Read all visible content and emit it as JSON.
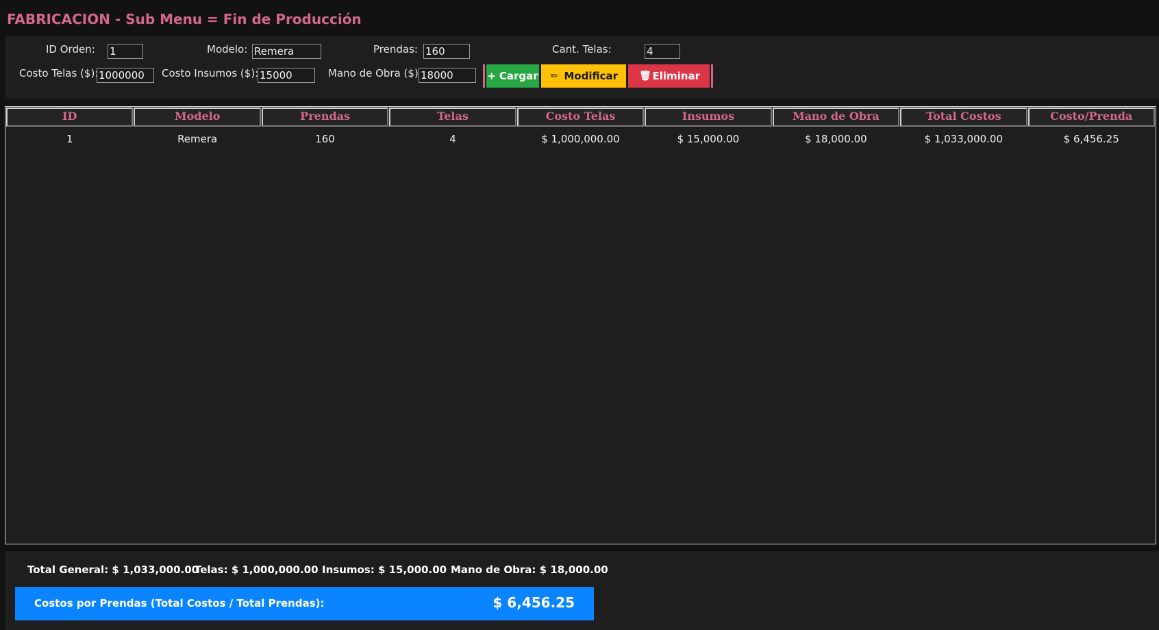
{
  "window": {
    "title": "FABRICACION - Sub Menu = Fin de Producción"
  },
  "form": {
    "id_orden": {
      "label": "ID Orden:",
      "value": "1"
    },
    "modelo": {
      "label": "Modelo:",
      "value": "Remera"
    },
    "prendas": {
      "label": "Prendas:",
      "value": "160"
    },
    "cant_telas": {
      "label": "Cant. Telas:",
      "value": "4"
    },
    "costo_telas": {
      "label": "Costo Telas ($):",
      "value": "1000000"
    },
    "costo_insumos": {
      "label": "Costo Insumos ($):",
      "value": "15000"
    },
    "mano_obra": {
      "label": "Mano de Obra ($):",
      "value": "18000"
    }
  },
  "buttons": {
    "cargar": {
      "label": "Cargar",
      "icon": "plus-icon",
      "glyph": "+",
      "color": "#28a745"
    },
    "modificar": {
      "label": "Modificar",
      "icon": "pencil-icon",
      "glyph": "✏",
      "color": "#ffc107"
    },
    "eliminar": {
      "label": "Eliminar",
      "icon": "trash-icon",
      "glyph": "🗑",
      "color": "#dc3545"
    }
  },
  "table": {
    "columns": [
      "ID",
      "Modelo",
      "Prendas",
      "Telas",
      "Costo Telas",
      "Insumos",
      "Mano de Obra",
      "Total Costos",
      "Costo/Prenda"
    ],
    "rows": [
      [
        "1",
        "Remera",
        "160",
        "4",
        "$ 1,000,000.00",
        "$ 15,000.00",
        "$ 18,000.00",
        "$ 1,033,000.00",
        "$ 6,456.25"
      ]
    ]
  },
  "totals": {
    "general": "Total General: $ 1,033,000.00",
    "telas": "Telas: $ 1,000,000.00",
    "insumos": "Insumos: $ 15,000.00",
    "mano_obra": "Mano de Obra: $ 18,000.00"
  },
  "costo_por_prenda": {
    "label": "Costos por Prendas (Total Costos / Total Prendas):",
    "value": "$ 6,456.25"
  },
  "colors": {
    "accent_pink": "#d4688c",
    "background": "#121212",
    "panel": "#1e1e1e",
    "highlight_blue": "#0a84ff"
  }
}
